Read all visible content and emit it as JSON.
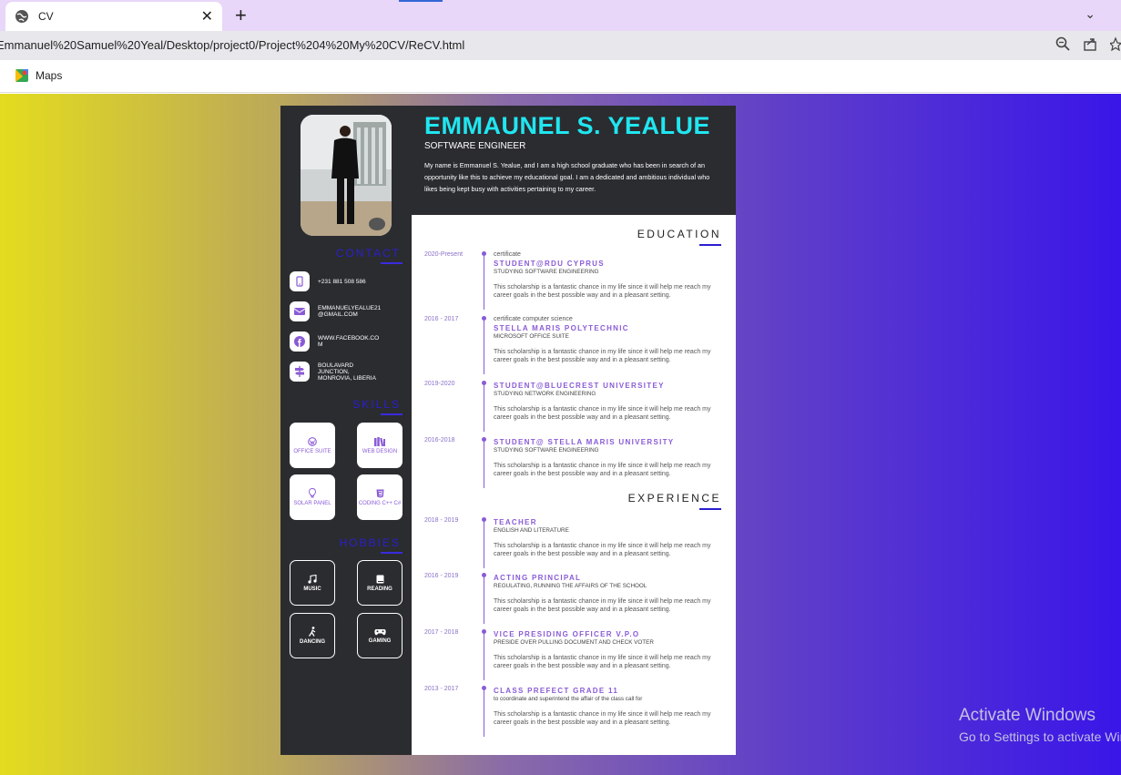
{
  "browser": {
    "tab_title": "CV",
    "url": "Emmanuel%20Samuel%20Yeal/Desktop/project0/Project%204%20My%20CV/ReCV.html",
    "bookmark": "Maps"
  },
  "os_watermark": {
    "line1": "Activate Windows",
    "line2": "Go to Settings to activate Windows."
  },
  "colors": {
    "accent_name": "#20e6f0",
    "accent_purple": "#8a5bd6",
    "sidebar_bg": "#2b2c30",
    "title_blue": "#2a1fd0"
  },
  "header": {
    "name": "EMMAUNEL S. YEALUE",
    "role": "SOFTWARE ENGINEER",
    "about": "My name is Emmanuel S. Yealue, and I am a high school graduate who has been in search of an opportunity like this to achieve my educational goal. I am a dedicated and ambitious individual who likes being kept busy with activities pertaining to my career."
  },
  "sidebar": {
    "contact_title": "CONTACT",
    "contact": [
      {
        "icon": "phone-icon",
        "text": "+231 881 508 586"
      },
      {
        "icon": "email-icon",
        "text": "EMMANUELYEALUE21 @GMAIL.COM"
      },
      {
        "icon": "facebook-icon",
        "text": "WWW.FACEBOOK.CO M"
      },
      {
        "icon": "signpost-icon",
        "text": "BOULAVARD JUNCTION, MONROVIA, LIBERIA"
      }
    ],
    "skills_title": "SKILLS",
    "skills": [
      {
        "icon": "wordpress-icon",
        "label": "OFFICE SUITE"
      },
      {
        "icon": "books-icon",
        "label": "WEB DESIGN"
      },
      {
        "icon": "lightbulb-icon",
        "label": "SOLAR PANEL"
      },
      {
        "icon": "css3-icon",
        "label": "CODING C++ C#"
      }
    ],
    "hobbies_title": "HOBBIES",
    "hobbies": [
      {
        "icon": "music-icon",
        "label": "MUSIC"
      },
      {
        "icon": "book-icon",
        "label": "READING"
      },
      {
        "icon": "dancing-icon",
        "label": "DANCING"
      },
      {
        "icon": "gamepad-icon",
        "label": "GAMING"
      }
    ]
  },
  "education": {
    "title": "EDUCATION",
    "items": [
      {
        "date": "2020-Present",
        "cert": "certificate",
        "org": "STUDENT@RDU CYPRUS",
        "sub": "STUDYING SOFTWARE ENGINEERING",
        "desc": "This scholarship is a fantastic chance in my life since it will help me reach my career goals in the best possible way and in a pleasant setting."
      },
      {
        "date": "2016 - 2017",
        "cert": "certificate computer science",
        "org": "STELLA MARIS POLYTECHNIC",
        "sub": "MICROSOFT OFFICE SUITE",
        "desc": "This scholarship is a fantastic chance in my life since it will help me reach my career goals in the best possible way and in a pleasant setting."
      },
      {
        "date": "2019-2020",
        "cert": "",
        "org": "STUDENT@BLUECREST UNIVERSITEY",
        "sub": "STUDYING NETWORK ENGINEERING",
        "desc": "This scholarship is a fantastic chance in my life since it will help me reach my career goals in the best possible way and in a pleasant setting."
      },
      {
        "date": "2016-2018",
        "cert": "",
        "org": "STUDENT@ STELLA MARIS UNIVERSITY",
        "sub": "STUDYING SOFTWARE ENGINEERING",
        "desc": "This scholarship is a fantastic chance in my life since it will help me reach my career goals in the best possible way and in a pleasant setting."
      }
    ]
  },
  "experience": {
    "title": "EXPERIENCE",
    "items": [
      {
        "date": "2018 - 2019",
        "org": "TEACHER",
        "sub": "ENGLISH AND LITERATURE",
        "desc": "This scholarship is a fantastic chance in my life since it will help me reach my career goals in the best possible way and in a pleasant setting."
      },
      {
        "date": "2016 - 2019",
        "org": "ACTING PRINCIPAL",
        "sub": "REGULATING, RUNNING THE AFFAIRS OF THE SCHOOL",
        "desc": "This scholarship is a fantastic chance in my life since it will help me reach my career goals in the best possible way and in a pleasant setting."
      },
      {
        "date": "2017 - 2018",
        "org": "VICE PRESIDING OFFICER V.P.O",
        "sub": "PRESIDE OVER PULLING DOCUMENT AND CHECK VOTER",
        "desc": "This scholarship is a fantastic chance in my life since it will help me reach my career goals in the best possible way and in a pleasant setting."
      },
      {
        "date": "2013 - 2017",
        "org": "CLASS PREFECT GRADE 11",
        "sub": "to coordinate and superintend the affair of the class call for",
        "desc": "This scholarship is a fantastic chance in my life since it will help me reach my career goals in the best possible way and in a pleasant setting."
      }
    ]
  }
}
